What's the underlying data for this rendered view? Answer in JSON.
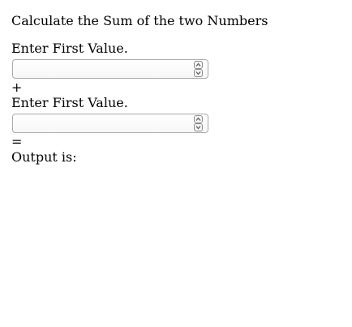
{
  "header": {
    "title": "Calculate the Sum of the two Numbers"
  },
  "form": {
    "first_label": "Enter First Value.",
    "first_value": "",
    "plus_symbol": "+",
    "second_label": "Enter First Value.",
    "second_value": "",
    "equals_symbol": "=",
    "output_label": "Output is:"
  },
  "icons": {
    "spin_up": "chevron-up-icon",
    "spin_down": "chevron-down-icon"
  },
  "colors": {
    "text": "#000000",
    "field_border": "#a9a9a9",
    "background": "#ffffff"
  }
}
